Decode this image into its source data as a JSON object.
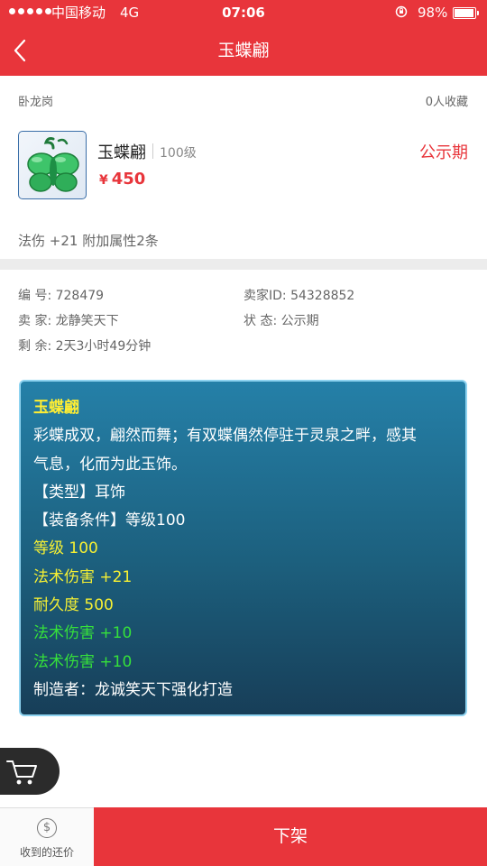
{
  "status_bar": {
    "carrier": "中国移动",
    "network": "4G",
    "time": "07:06",
    "battery": "98%"
  },
  "nav": {
    "title": "玉蝶翩"
  },
  "item": {
    "shop": "卧龙岗",
    "favorites": "0人收藏",
    "name": "玉蝶翩",
    "level": "100级",
    "currency": "¥",
    "price": "450",
    "status": "公示期",
    "attributes": "法伤 +21  附加属性2条"
  },
  "info": {
    "id": "编  号: 728479",
    "seller_id": "卖家ID: 54328852",
    "seller": "卖  家: 龙静笑天下",
    "state": "状  态: 公示期",
    "remaining": "剩  余: 2天3小时49分钟"
  },
  "description": {
    "title": "玉蝶翩",
    "lore_1": "彩蝶成双，翩然而舞；有双蝶偶然停驻于灵泉之畔，感其",
    "lore_2": "气息，化而为此玉饰。",
    "type": "【类型】耳饰",
    "requirement": "【装备条件】等级100",
    "level": "等级 100",
    "magic_damage": "法术伤害 +21",
    "durability": "耐久度 500",
    "extra_1": "法术伤害 +10",
    "extra_2": "法术伤害 +10",
    "maker": "制造者：龙诚笑天下强化打造"
  },
  "bottom_bar": {
    "offers_label": "收到的还价",
    "coin_symbol": "$",
    "action_label": "下架"
  },
  "colors": {
    "brand_red": "#e8353b",
    "card_border": "#8ed3f0",
    "title_yellow": "#ffee33",
    "stat_yellow": "#f6f033",
    "bonus_green": "#35e03b"
  },
  "icons": [
    "back-arrow-icon",
    "rotation-lock-icon",
    "battery-icon",
    "cart-icon",
    "coin-icon"
  ]
}
